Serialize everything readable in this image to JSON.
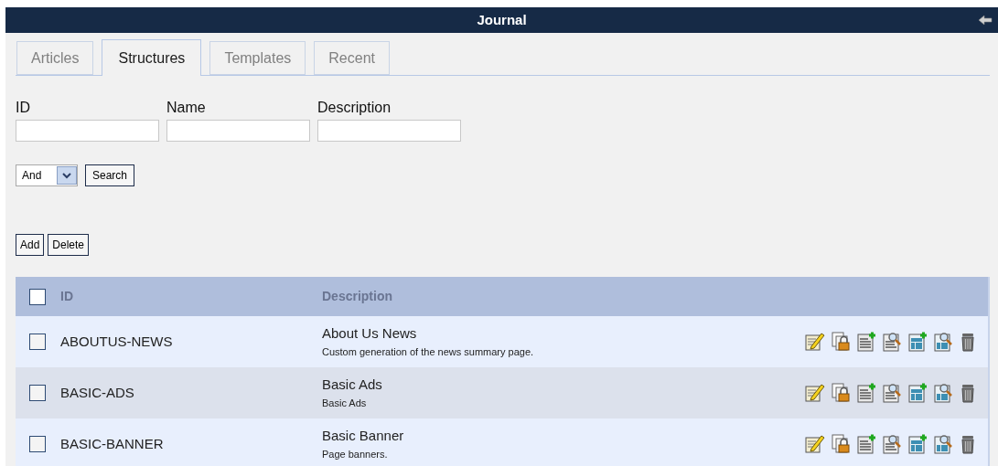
{
  "window": {
    "title": "Journal"
  },
  "tabs": [
    {
      "label": "Articles",
      "selected": false
    },
    {
      "label": "Structures",
      "selected": true
    },
    {
      "label": "Templates",
      "selected": false
    },
    {
      "label": "Recent",
      "selected": false
    }
  ],
  "search_fields": [
    {
      "label": "ID"
    },
    {
      "label": "Name"
    },
    {
      "label": "Description"
    }
  ],
  "match_select": {
    "value": "And"
  },
  "search_button": "Search",
  "actions": [
    "Add",
    "Delete"
  ],
  "table": {
    "select_all": {
      "checked": false
    },
    "columns": [
      "ID",
      "Description"
    ],
    "rows": [
      {
        "checked": false,
        "id": "ABOUTUS-NEWS",
        "name": "About Us News",
        "description": "Custom generation of the news summary page."
      },
      {
        "checked": false,
        "id": "BASIC-ADS",
        "name": "Basic Ads",
        "description": "Basic Ads"
      },
      {
        "checked": false,
        "id": "BASIC-BANNER",
        "name": "Basic Banner",
        "description": "Page banners."
      }
    ]
  }
}
